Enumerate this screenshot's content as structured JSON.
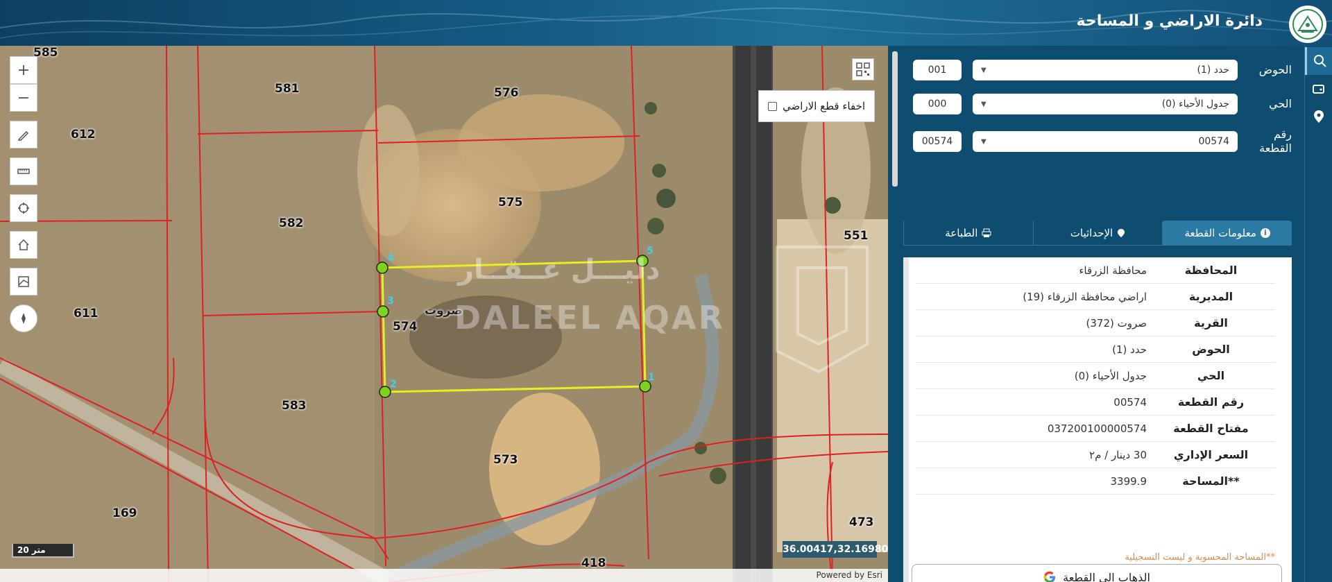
{
  "header": {
    "title": "دائرة الاراضي و المساحة"
  },
  "map": {
    "parcels": [
      {
        "id": "585",
        "label": "585"
      },
      {
        "id": "581",
        "label": "581"
      },
      {
        "id": "576",
        "label": "576"
      },
      {
        "id": "612",
        "label": "612"
      },
      {
        "id": "575",
        "label": "575"
      },
      {
        "id": "582",
        "label": "582"
      },
      {
        "id": "551",
        "label": "551"
      },
      {
        "id": "611",
        "label": "611"
      },
      {
        "id": "574",
        "label": "574"
      },
      {
        "id": "583",
        "label": "583"
      },
      {
        "id": "573",
        "label": "573"
      },
      {
        "id": "169",
        "label": "169"
      },
      {
        "id": "473",
        "label": "473"
      },
      {
        "id": "418",
        "label": "418"
      }
    ],
    "village_label": "صروت",
    "vertices": [
      "1",
      "2",
      "3",
      "4",
      "5"
    ],
    "hide_parcels_label": "اخفاء قطع الاراضي",
    "scale_label": "20 متر",
    "coordinates": "36.00417,32.16980",
    "attribution": "Powered by Esri",
    "watermark_ar": "دليـــل عــقــار",
    "watermark_en": "DALEEL AQAR"
  },
  "form": {
    "basin": {
      "label": "الحوض",
      "value": "حدد (1)",
      "code": "001"
    },
    "district": {
      "label": "الحي",
      "value": "جدول الأحياء (0)",
      "code": "000"
    },
    "parcel": {
      "label": "رقم القطعة",
      "value": "00574",
      "code": "00574"
    }
  },
  "tabs": [
    {
      "label": "معلومات القطعة",
      "icon": "info-icon",
      "active": true
    },
    {
      "label": "الإحداثيات",
      "icon": "location-pin-icon",
      "active": false
    },
    {
      "label": "الطباعة",
      "icon": "printer-icon",
      "active": false
    }
  ],
  "info": {
    "rows": [
      {
        "key": "المحافظة",
        "value": "محافظة الزرقاء"
      },
      {
        "key": "المديرية",
        "value": "اراضي محافظة الزرقاء (19)"
      },
      {
        "key": "القرية",
        "value": "صروت (372)"
      },
      {
        "key": "الحوض",
        "value": "حدد (1)"
      },
      {
        "key": "الحي",
        "value": "جدول الأحياء (0)"
      },
      {
        "key": "رقم القطعة",
        "value": "00574"
      },
      {
        "key": "مفتاح القطعة",
        "value": "037200100000574"
      },
      {
        "key": "السعر الإداري",
        "value": "30 دينار / م٢"
      },
      {
        "key": "**المساحة",
        "value": "3399.9"
      }
    ],
    "note": "**المساحة المحسوبة و ليست التسجيلية",
    "goto_label": "الذهاب الى القطعة"
  },
  "colors": {
    "header_bg": "#155a82",
    "panel_bg": "#0f4d70",
    "active_tab": "#2b7aa3",
    "parcel_lines": "#e02020",
    "selected_parcel": "#e6f020",
    "vertex_fill": "#7ed321"
  }
}
